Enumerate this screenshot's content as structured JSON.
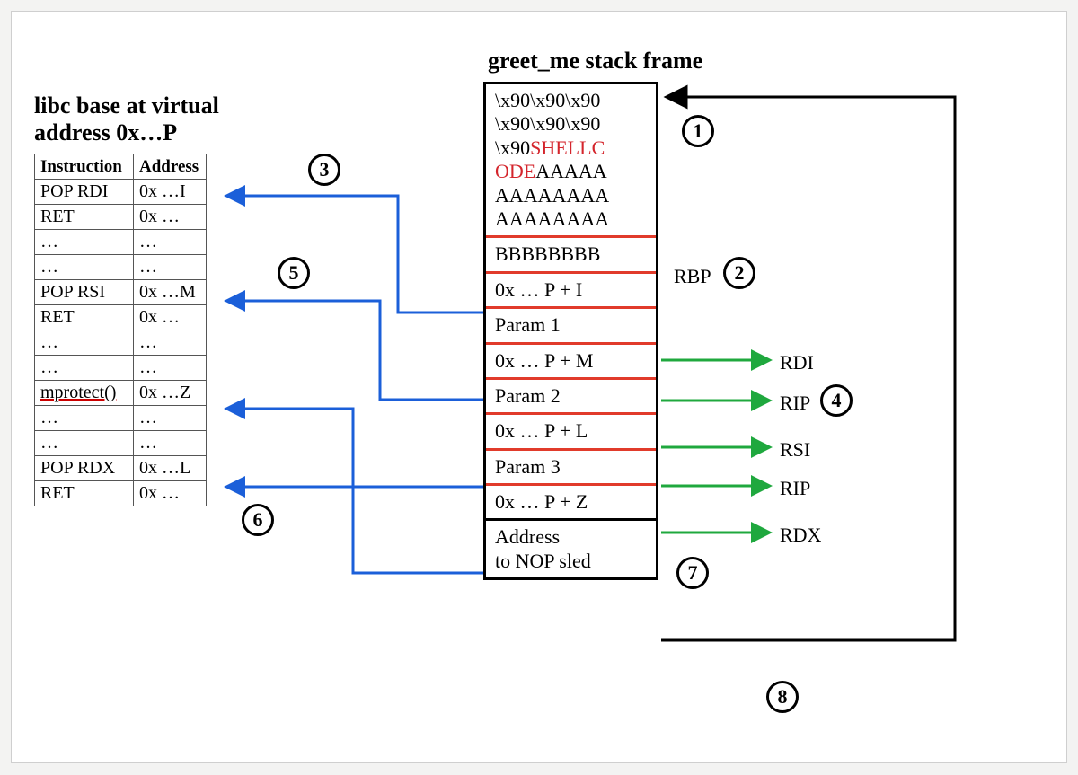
{
  "libc": {
    "title_l1": "libc base at virtual",
    "title_l2": "address  0x…P",
    "headers": {
      "instr": "Instruction",
      "addr": "Address"
    },
    "rows": [
      {
        "instr": "POP RDI",
        "addr": "0x …I"
      },
      {
        "instr": "RET",
        "addr": "0x …"
      },
      {
        "instr": "…",
        "addr": "…"
      },
      {
        "instr": "…",
        "addr": "…"
      },
      {
        "instr": "POP RSI",
        "addr": "0x …M"
      },
      {
        "instr": "RET",
        "addr": "0x …"
      },
      {
        "instr": "…",
        "addr": "…"
      },
      {
        "instr": "…",
        "addr": "…"
      },
      {
        "instr": "mprotect()",
        "addr": "0x …Z",
        "underline": true
      },
      {
        "instr": "…",
        "addr": "…"
      },
      {
        "instr": "…",
        "addr": "…"
      },
      {
        "instr": "POP RDX",
        "addr": "0x …L"
      },
      {
        "instr": "RET",
        "addr": "0x …"
      }
    ]
  },
  "stack": {
    "title": "greet_me stack frame",
    "buf_line1": "\\x90\\x90\\x90",
    "buf_line2": "\\x90\\x90\\x90",
    "buf_line3_pre": "\\x90",
    "buf_line3_shell1": "SHELLC",
    "buf_line4_shell2": "ODE",
    "buf_line4_post": "AAAAA",
    "buf_line5": "AAAAAAAA",
    "buf_line6": "AAAAAAAA",
    "rbp": "BBBBBBBB",
    "r1": "0x … P + I",
    "p1": "Param 1",
    "r2": "0x … P + M",
    "p2": "Param 2",
    "r3": "0x … P + L",
    "p3": "Param 3",
    "r4": "0x … P + Z",
    "tail1": "Address",
    "tail2": "to NOP sled"
  },
  "reglabels": {
    "rbp": "RBP",
    "rdi": "RDI",
    "rip1": "RIP",
    "rsi": "RSI",
    "rip2": "RIP",
    "rdx": "RDX"
  },
  "badges": {
    "b1": "1",
    "b2": "2",
    "b3": "3",
    "b4": "4",
    "b5": "5",
    "b6": "6",
    "b7": "7",
    "b8": "8"
  }
}
